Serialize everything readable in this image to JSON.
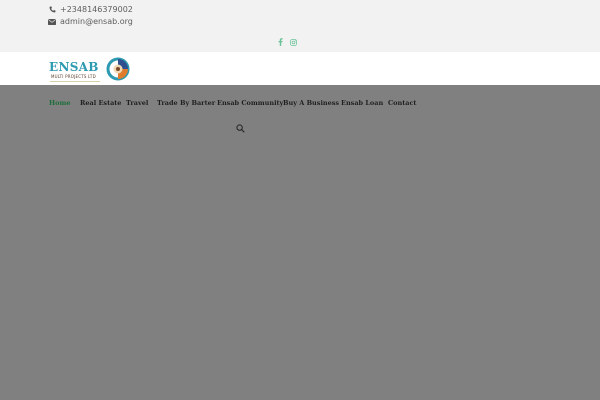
{
  "topbar": {
    "phone": "+2348146379002",
    "email": "admin@ensab.org",
    "phone_icon": "phone-icon",
    "email_icon": "envelope-icon",
    "social": [
      "facebook-icon",
      "instagram-icon"
    ]
  },
  "logo": {
    "name": "ENSAB",
    "subtitle": "MULTI PROJECTS LTD"
  },
  "nav": {
    "items": [
      {
        "label": "Home",
        "active": true
      },
      {
        "label": "Real Estate"
      },
      {
        "label": "Travel"
      },
      {
        "label": "Trade By Barter"
      },
      {
        "label": "Ensab Community"
      },
      {
        "label": "Buy A Business"
      },
      {
        "label": "Ensab Loan"
      },
      {
        "label": "Contact"
      }
    ],
    "search_icon": "search-icon"
  },
  "colors": {
    "overlay": "#808080",
    "topbar_bg": "#f2f2f2",
    "active_nav": "#1d6e3a",
    "social": "#6cc39a",
    "logo_primary": "#2c9ab0"
  }
}
